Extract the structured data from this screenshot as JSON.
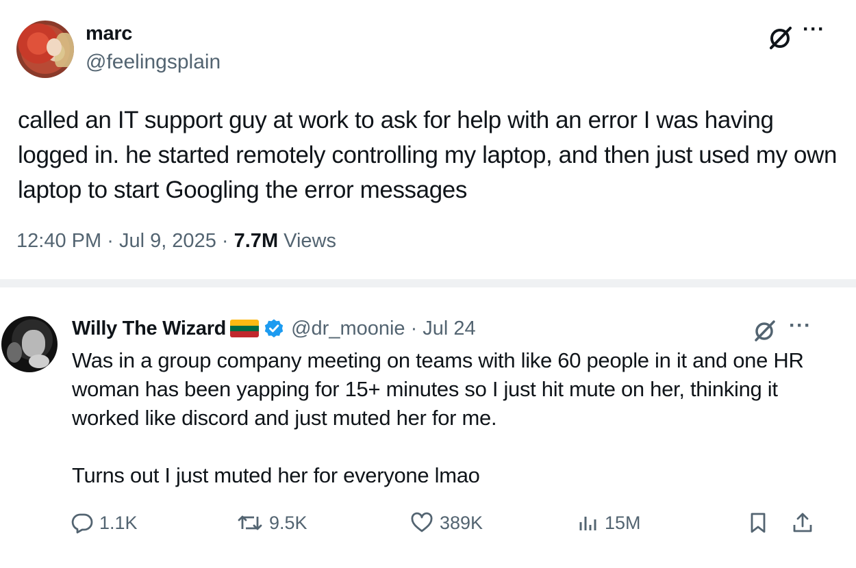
{
  "tweet": {
    "author_name": "marc",
    "author_handle": "@feelingsplain",
    "avatar_icon": "user-avatar-photo",
    "text": "called an IT support guy at work to ask for help with an error I was having logged in. he started remotely controlling my laptop, and then just used my own laptop to start Googling the error messages",
    "time": "12:40 PM",
    "date": "Jul 9, 2025",
    "separator": "·",
    "views_count": "7.7M",
    "views_label": "Views",
    "grok_icon": "grok-icon",
    "more_icon": "more-icon",
    "more_label": "···"
  },
  "reply": {
    "author_name": "Willy The Wizard",
    "flag_colors": [
      "#fdb913",
      "#006a44",
      "#c1272d"
    ],
    "verified_color": "#1d9bf0",
    "author_handle": "@dr_moonie",
    "separator": "·",
    "date": "Jul 24",
    "more_label": "···",
    "text_paragraphs": [
      "Was in a group company meeting on teams with like 60 people in it and one HR woman has been yapping for 15+ minutes so I just hit mute on her, thinking it worked like discord and just muted her for me.",
      "Turns out I just muted her for everyone lmao"
    ],
    "actions": {
      "replies": "1.1K",
      "reposts": "9.5K",
      "likes": "389K",
      "views": "15M"
    }
  },
  "colors": {
    "text_primary": "#0f1419",
    "text_secondary": "#536471",
    "divider": "#eff1f3"
  }
}
